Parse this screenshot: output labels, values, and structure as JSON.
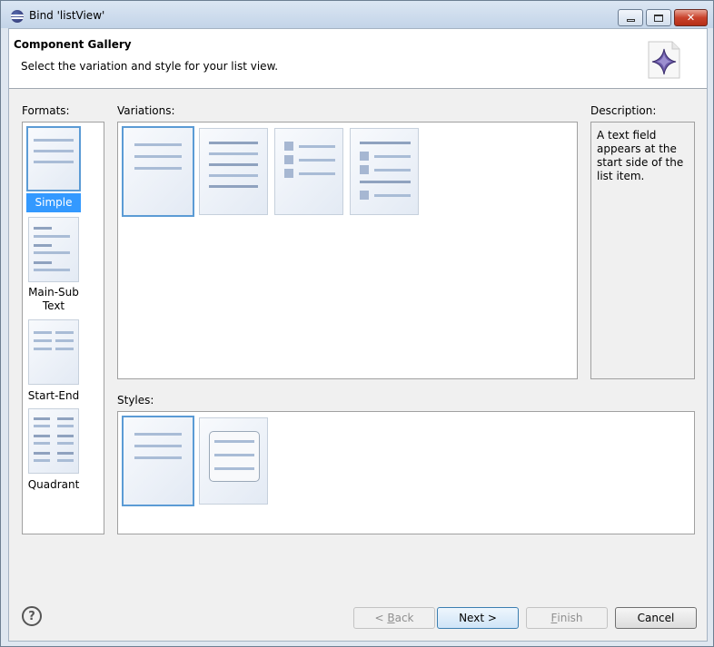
{
  "window": {
    "title": "Bind 'listView'",
    "close_glyph": "✕"
  },
  "header": {
    "title": "Component Gallery",
    "subtitle": "Select the variation and style for your list view."
  },
  "formats": {
    "label": "Formats:",
    "items": [
      {
        "label": "Simple",
        "selected": true
      },
      {
        "label": "Main-Sub Text",
        "label_line1": "Main-Sub",
        "label_line2": "Text",
        "selected": false
      },
      {
        "label": "Start-End",
        "selected": false
      },
      {
        "label": "Quadrant",
        "selected": false
      }
    ]
  },
  "variations": {
    "label": "Variations:",
    "count": 4,
    "selected_index": 0
  },
  "styles": {
    "label": "Styles:",
    "count": 2,
    "selected_index": 0
  },
  "description": {
    "label": "Description:",
    "text": "A text field appears at the start side of the list item."
  },
  "buttons": {
    "help_glyph": "?",
    "back_prefix": "< ",
    "back_mnemonic": "B",
    "back_rest": "ack",
    "next": "Next >",
    "finish_mnemonic": "F",
    "finish_rest": "inish",
    "cancel": "Cancel"
  },
  "colors": {
    "selection": "#3399ff",
    "thumb_border_selected": "#5b9bd5",
    "thumb_bar": "#a9bcd6"
  }
}
